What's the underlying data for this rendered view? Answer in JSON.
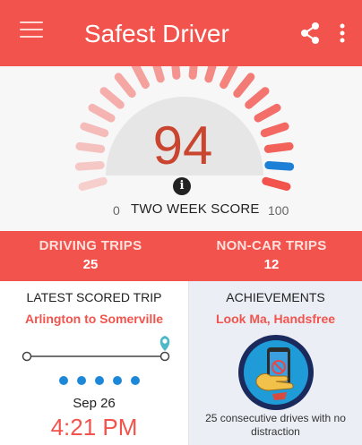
{
  "app": {
    "title": "Safest Driver",
    "accent_color": "#f2544d",
    "icons": {
      "menu": "hamburger-icon",
      "share": "share-icon",
      "more": "more-vert-icon"
    }
  },
  "score": {
    "value": "94",
    "scale_min": "0",
    "scale_label": "TWO WEEK SCORE",
    "scale_max": "100",
    "info_icon": "i"
  },
  "stats": {
    "driving_trips_label": "DRIVING TRIPS",
    "driving_trips_value": "25",
    "non_car_trips_label": "NON-CAR TRIPS",
    "non_car_trips_value": "12"
  },
  "latest_trip": {
    "heading": "LATEST SCORED TRIP",
    "route": "Arlington to Somerville",
    "date": "Sep 26",
    "time": "4:21 PM"
  },
  "achievements": {
    "heading": "ACHIEVEMENTS",
    "title": "Look Ma, Handsfree",
    "description": "25 consecutive drives with no distraction",
    "badge_icon": "hand-holding-phone-icon"
  }
}
